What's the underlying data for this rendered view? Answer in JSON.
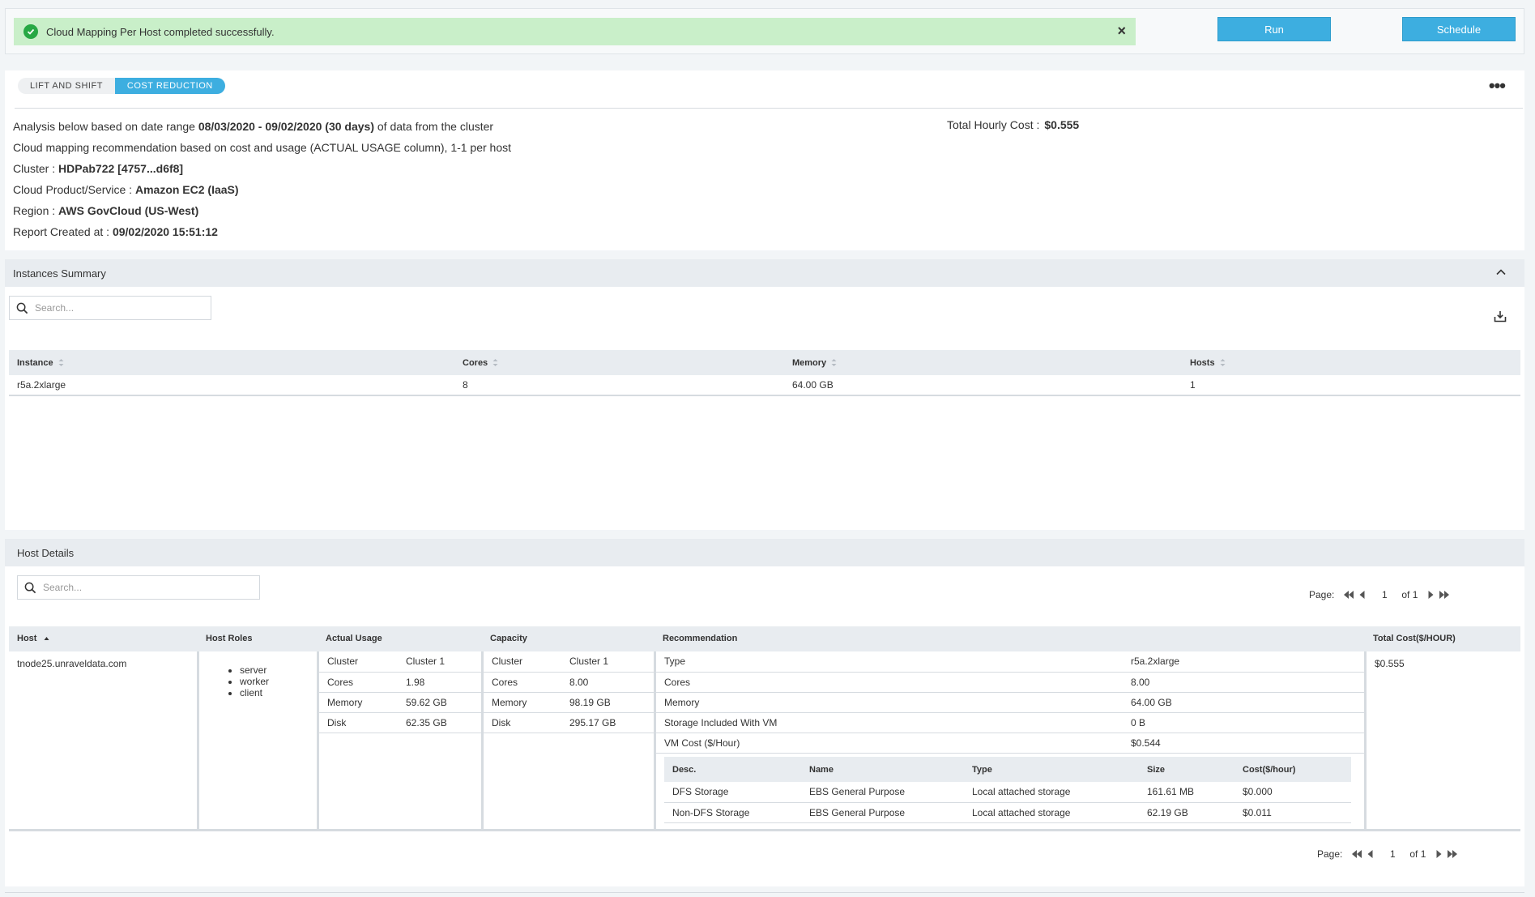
{
  "banner": {
    "message": "Cloud Mapping Per Host completed successfully.",
    "close_label": "×"
  },
  "actions": {
    "run_label": "Run",
    "schedule_label": "Schedule"
  },
  "tabs": [
    {
      "label": "LIFT AND SHIFT",
      "active": false
    },
    {
      "label": "COST REDUCTION",
      "active": true
    }
  ],
  "more_label": "•••",
  "summary": {
    "analysis_prefix": "Analysis below based on date range ",
    "date_range": "08/03/2020 - 09/02/2020 (30 days)",
    "analysis_suffix": " of data from the cluster",
    "recommendation_text": "Cloud mapping recommendation based on cost and usage (ACTUAL USAGE column), 1-1 per host",
    "cluster_label": "Cluster : ",
    "cluster_value": "HDPab722 [4757...d6f8]",
    "product_label": "Cloud Product/Service : ",
    "product_value": "Amazon EC2 (IaaS)",
    "region_label": "Region : ",
    "region_value": "AWS GovCloud (US-West)",
    "created_label": "Report Created at : ",
    "created_value": "09/02/2020 15:51:12",
    "total_hourly_label": "Total Hourly Cost :",
    "total_hourly_value": "$0.555"
  },
  "instances": {
    "title": "Instances Summary",
    "search_placeholder": "Search...",
    "columns": [
      "Instance",
      "Cores",
      "Memory",
      "Hosts"
    ],
    "rows": [
      [
        "r5a.2xlarge",
        "8",
        "64.00 GB",
        "1"
      ]
    ]
  },
  "host_details": {
    "title": "Host Details",
    "search_placeholder": "Search...",
    "pager": {
      "label": "Page:",
      "page": "1",
      "of": "of 1"
    },
    "columns": {
      "host": "Host",
      "roles": "Host Roles",
      "actual": "Actual Usage",
      "capacity": "Capacity",
      "recommendation": "Recommendation",
      "total_cost": "Total Cost($/HOUR)"
    },
    "row": {
      "host": "tnode25.unraveldata.com",
      "roles": [
        "server",
        "worker",
        "client"
      ],
      "actual_usage": [
        [
          "Cluster",
          "Cluster 1"
        ],
        [
          "Cores",
          "1.98"
        ],
        [
          "Memory",
          "59.62 GB"
        ],
        [
          "Disk",
          "62.35 GB"
        ]
      ],
      "capacity": [
        [
          "Cluster",
          "Cluster 1"
        ],
        [
          "Cores",
          "8.00"
        ],
        [
          "Memory",
          "98.19 GB"
        ],
        [
          "Disk",
          "295.17 GB"
        ]
      ],
      "recommendation": [
        [
          "Type",
          "r5a.2xlarge"
        ],
        [
          "Cores",
          "8.00"
        ],
        [
          "Memory",
          "64.00 GB"
        ],
        [
          "Storage Included With VM",
          "0 B"
        ],
        [
          "VM Cost ($/Hour)",
          "$0.544"
        ]
      ],
      "storage_columns": [
        "Desc.",
        "Name",
        "Type",
        "Size",
        "Cost($/hour)"
      ],
      "storage_rows": [
        [
          "DFS Storage",
          "EBS General Purpose",
          "Local attached storage",
          "161.61 MB",
          "$0.000"
        ],
        [
          "Non-DFS Storage",
          "EBS General Purpose",
          "Local attached storage",
          "62.19 GB",
          "$0.011"
        ]
      ],
      "total_cost": "$0.555"
    }
  },
  "colors": {
    "accent": "#3daee0",
    "success_bg": "#c9efc9",
    "success_icon": "#27a844"
  }
}
